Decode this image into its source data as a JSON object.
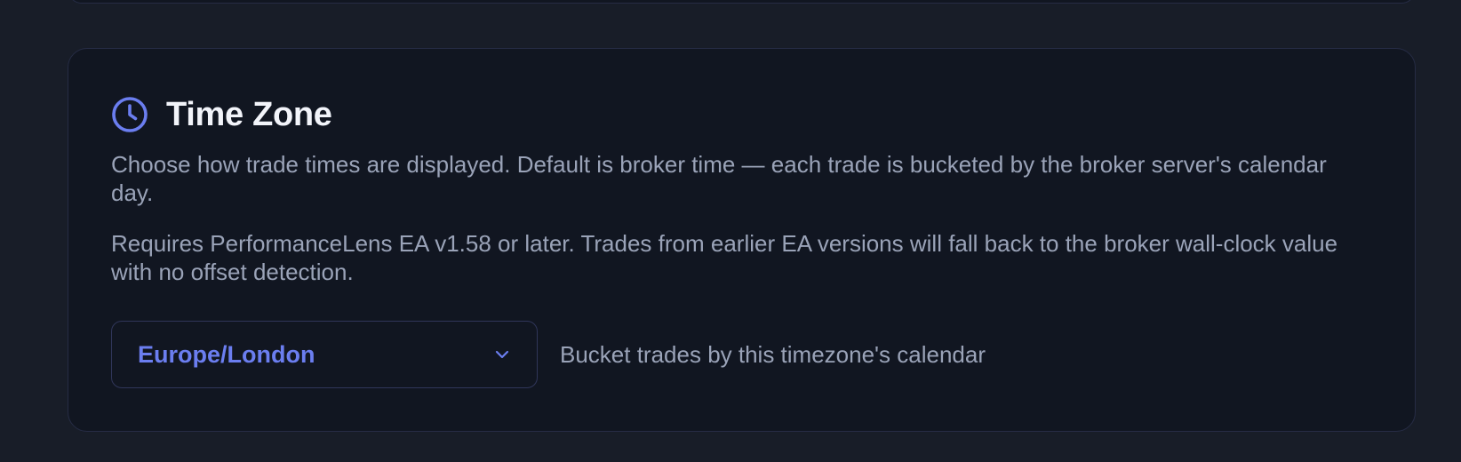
{
  "colors": {
    "page_background": "#181d28",
    "card_background": "#111621",
    "card_border": "#262c45",
    "accent": "#6b7ef0",
    "title_text": "#f2f4fa",
    "muted_text": "#9aa3b8"
  },
  "timezone_section": {
    "icon": "clock-icon",
    "title": "Time Zone",
    "description": "Choose how trade times are displayed. Default is broker time — each trade is bucketed by the broker server's calendar day.",
    "requirement_note": "Requires PerformanceLens EA v1.58 or later. Trades from earlier EA versions will fall back to the broker wall-clock value with no offset detection.",
    "timezone_select": {
      "selected_value": "Europe/London",
      "icon": "chevron-down-icon"
    },
    "select_hint": "Bucket trades by this timezone's calendar"
  }
}
